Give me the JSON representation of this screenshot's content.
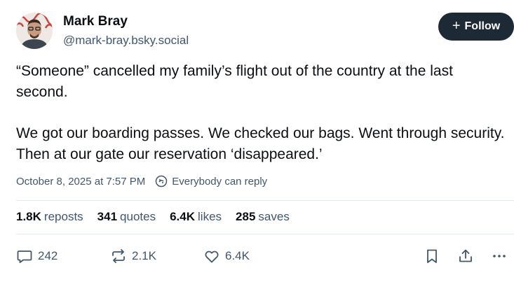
{
  "author": {
    "name": "Mark Bray",
    "handle": "@mark-bray.bsky.social",
    "avatar_icon": "profile-photo"
  },
  "follow": {
    "label": "Follow",
    "icon": "plus-icon",
    "bg_color": "#1e2936"
  },
  "post": {
    "paragraphs": [
      "“Someone” cancelled my family’s flight out of the country at the last second.",
      "We got our boarding passes. We checked our bags. Went through security. Then at our gate our reservation ‘disappeared.’"
    ],
    "date": "October 8, 2025 at 7:57 PM",
    "reply_setting": "Everybody can reply"
  },
  "stats": [
    {
      "value": "1.8K",
      "label": "reposts"
    },
    {
      "value": "341",
      "label": "quotes"
    },
    {
      "value": "6.4K",
      "label": "likes"
    },
    {
      "value": "285",
      "label": "saves"
    }
  ],
  "actions": {
    "reply_count": "242",
    "repost_count": "2.1K",
    "like_count": "6.4K"
  },
  "colors": {
    "text": "#0b0f14",
    "muted": "#42576c",
    "divider": "#e4e9ee"
  }
}
